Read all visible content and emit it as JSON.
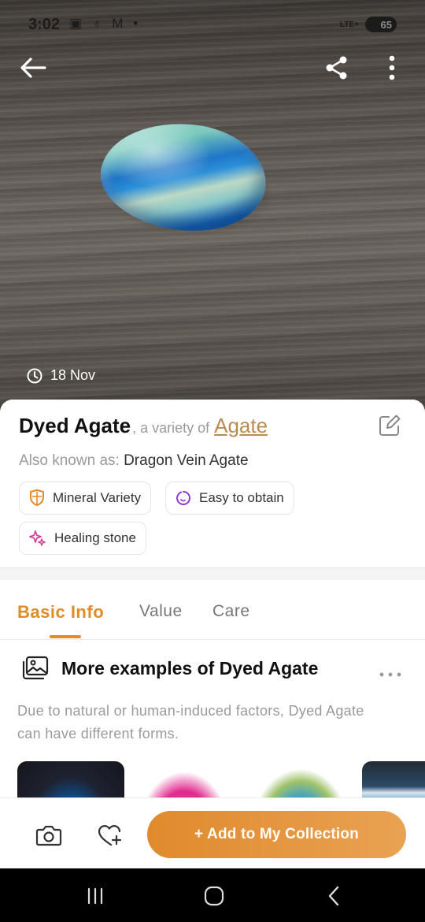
{
  "status_bar": {
    "time": "3:02",
    "icons": "▣ ♁ M •",
    "network": "LTE+",
    "battery": "65"
  },
  "hero": {
    "date": "18 Nov"
  },
  "icons": {
    "back": "arrow-left-icon",
    "share": "share-icon",
    "menu": "more-vertical-icon",
    "clock": "clock-icon",
    "edit": "edit-icon",
    "gallery": "gallery-icon",
    "camera": "camera-icon",
    "heart": "heart-plus-icon"
  },
  "card": {
    "name": "Dyed Agate",
    "variety_prefix": ", a variety of",
    "variety": "Agate",
    "aka_label": "Also known as:",
    "aka_value": "Dragon Vein Agate",
    "chips": [
      {
        "label": "Mineral Variety",
        "icon": "shield-icon",
        "color": "#e38b24"
      },
      {
        "label": "Easy to obtain",
        "icon": "gem-icon",
        "color": "#8e3bd1"
      },
      {
        "label": "Healing stone",
        "icon": "sparkles-icon",
        "color": "#d23f9a"
      }
    ]
  },
  "tabs": [
    {
      "label": "Basic Info",
      "active": true
    },
    {
      "label": "Value",
      "active": false
    },
    {
      "label": "Care",
      "active": false
    }
  ],
  "section": {
    "title": "More examples of Dyed Agate",
    "description": "Due to natural or human-induced factors, Dyed Agate can have different forms."
  },
  "actions": {
    "add_label": "+ Add to My Collection"
  },
  "colors": {
    "accent": "#e38b24",
    "link": "#b98a52"
  }
}
